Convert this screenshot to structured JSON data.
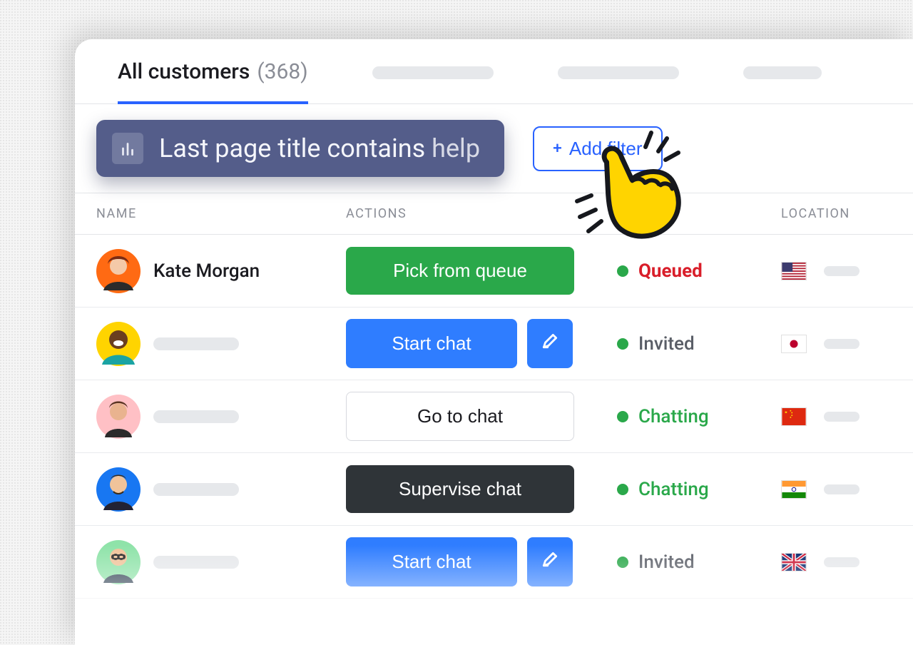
{
  "tabs": {
    "active": {
      "label": "All customers",
      "count": "(368)"
    }
  },
  "filter": {
    "prefix_label": "Last page title contains",
    "param": "help"
  },
  "add_filter_label": "Add filter",
  "columns": {
    "name": "NAME",
    "actions": "ACTIONS",
    "location": "LOCATION"
  },
  "actions": {
    "pick_from_queue": "Pick from queue",
    "start_chat": "Start chat",
    "go_to_chat": "Go to chat",
    "supervise_chat": "Supervise chat"
  },
  "status": {
    "queued": "Queued",
    "invited": "Invited",
    "chatting": "Chatting"
  },
  "rows": [
    {
      "name": "Kate Morgan",
      "avatar_bg": "#ff6a13",
      "action": "pick_from_queue",
      "status": "queued",
      "flag": "us"
    },
    {
      "name": "",
      "avatar_bg": "#ffd400",
      "action": "start_chat_edit",
      "status": "invited",
      "flag": "jp"
    },
    {
      "name": "",
      "avatar_bg": "#ffc0c5",
      "action": "go_to_chat",
      "status": "chatting",
      "flag": "cn"
    },
    {
      "name": "",
      "avatar_bg": "#1877f2",
      "action": "supervise_chat",
      "status": "chatting",
      "flag": "in"
    },
    {
      "name": "",
      "avatar_bg": "#8fe3a9",
      "action": "start_chat_edit",
      "status": "invited",
      "flag": "gb"
    }
  ],
  "colors": {
    "accent": "#2962ff",
    "chip_bg": "#545d8a",
    "green": "#2aa84a",
    "blue": "#2f7dff",
    "dark": "#2f3438",
    "queued_red": "#d91e2a"
  }
}
